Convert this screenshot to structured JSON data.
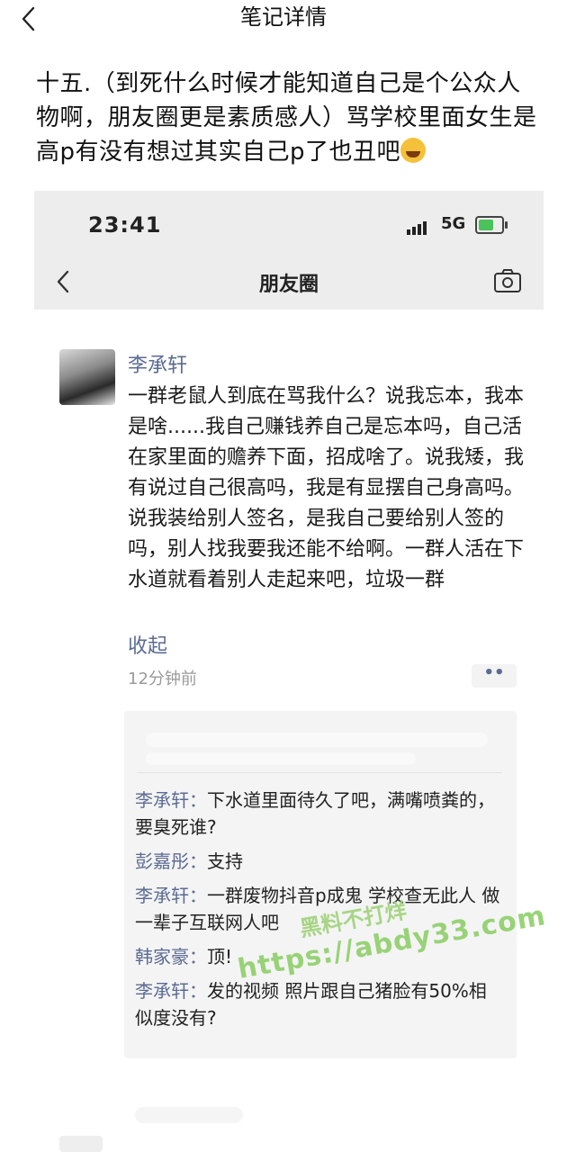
{
  "appbar": {
    "title": "笔记详情"
  },
  "note": {
    "text": "十五.（到死什么时候才能知道自己是个公众人物啊，朋友圈更是素质感人）骂学校里面女生是高p有没有想过其实自己p了也丑吧"
  },
  "phone": {
    "time": "23:41",
    "network": "5G",
    "page_title": "朋友圈"
  },
  "moment": {
    "author": "李承轩",
    "content": "一群老鼠人到底在骂我什么？说我忘本，我本是啥......我自己赚钱养自己是忘本吗，自己活在家里面的赡养下面，招成啥了。说我矮，我有说过自己很高吗，我是有显摆自己身高吗。说我装给别人签名，是我自己要给别人签的吗，别人找我要我还能不给啊。一群人活在下水道就看着别人走起来吧，垃圾一群",
    "collapse_label": "收起",
    "time_ago": "12分钟前",
    "more_label": "••"
  },
  "comments": [
    {
      "who": "李承轩：",
      "text": "下水道里面待久了吧，满嘴喷粪的，要臭死谁?"
    },
    {
      "who": "彭嘉彤：",
      "text": "支持"
    },
    {
      "who": "李承轩：",
      "text": "一群废物抖音p成鬼 学校查无此人 做一辈子互联网人吧"
    },
    {
      "who": "韩家豪：",
      "text": "顶!"
    },
    {
      "who": "李承轩：",
      "text": "发的视频 照片跟自己猪脸有50%相似度没有?"
    }
  ],
  "watermark": {
    "line1": "黑料不打烊",
    "line2": "https://abdy33.com"
  },
  "colors": {
    "link_blue": "#5b6b93",
    "phone_bar": "#ededed",
    "comment_bg": "#f4f4f4",
    "watermark_green": "#8fcf6a"
  }
}
